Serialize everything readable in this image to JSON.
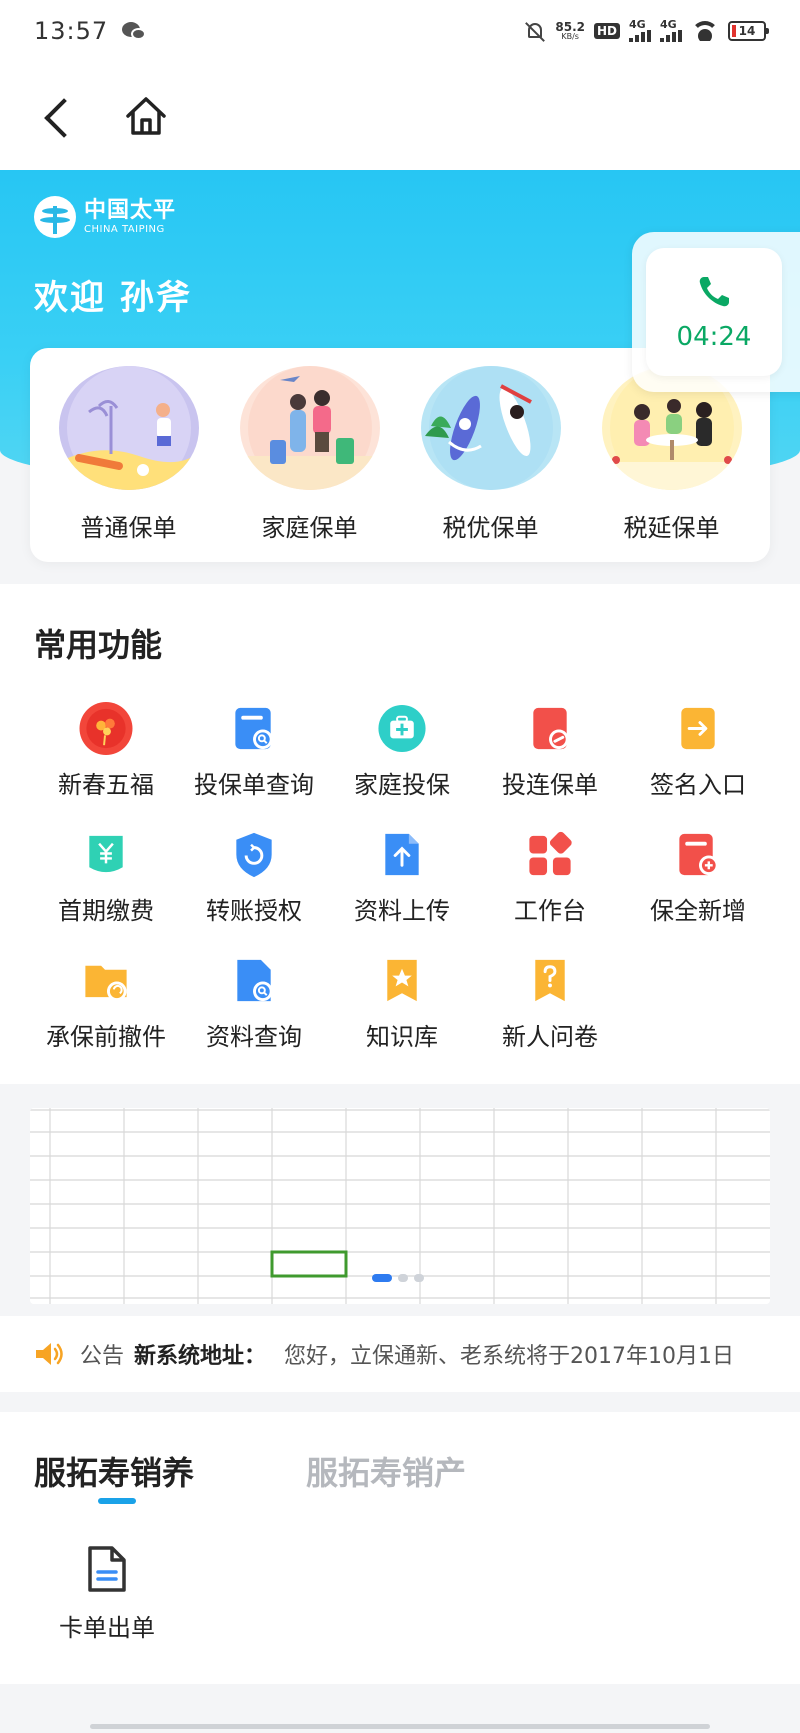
{
  "status_bar": {
    "time": "13:57",
    "speed_value": "85.2",
    "speed_unit": "KB/s",
    "hd": "HD",
    "net1": "4G",
    "net2": "4G",
    "battery": "14"
  },
  "hero": {
    "logo_cn": "中国太平",
    "logo_en": "CHINA TAIPING",
    "welcome": "欢迎 孙斧",
    "call_time": "04:24"
  },
  "policies": [
    {
      "label": "普通保单"
    },
    {
      "label": "家庭保单"
    },
    {
      "label": "税优保单"
    },
    {
      "label": "税延保单"
    }
  ],
  "functions": {
    "title": "常用功能",
    "items": [
      {
        "label": "新春五福",
        "icon": "red-balloon-icon"
      },
      {
        "label": "投保单查询",
        "icon": "doc-search-icon"
      },
      {
        "label": "家庭投保",
        "icon": "medical-kit-icon"
      },
      {
        "label": "投连保单",
        "icon": "link-doc-icon"
      },
      {
        "label": "签名入口",
        "icon": "sign-entry-icon"
      },
      {
        "label": "首期缴费",
        "icon": "yuan-payment-icon"
      },
      {
        "label": "转账授权",
        "icon": "shield-refresh-icon"
      },
      {
        "label": "资料上传",
        "icon": "file-upload-icon"
      },
      {
        "label": "工作台",
        "icon": "workbench-grid-icon"
      },
      {
        "label": "保全新增",
        "icon": "doc-add-icon"
      },
      {
        "label": "承保前撤件",
        "icon": "folder-undo-icon"
      },
      {
        "label": "资料查询",
        "icon": "file-search-icon"
      },
      {
        "label": "知识库",
        "icon": "bookmark-star-icon"
      },
      {
        "label": "新人问卷",
        "icon": "question-bookmark-icon"
      }
    ]
  },
  "notice": {
    "tag": "公告",
    "title": "新系统地址：",
    "text": "您好，立保通新、老系统将于2017年10月1日"
  },
  "tabs": {
    "active": "服拓寿销养",
    "inactive": "服拓寿销产"
  },
  "card_item": {
    "label": "卡单出单"
  },
  "colors": {
    "hero": "#27c6f3",
    "accent_blue": "#1aa2e8",
    "call_green": "#0aa864",
    "dot_active": "#2e7bf0"
  }
}
